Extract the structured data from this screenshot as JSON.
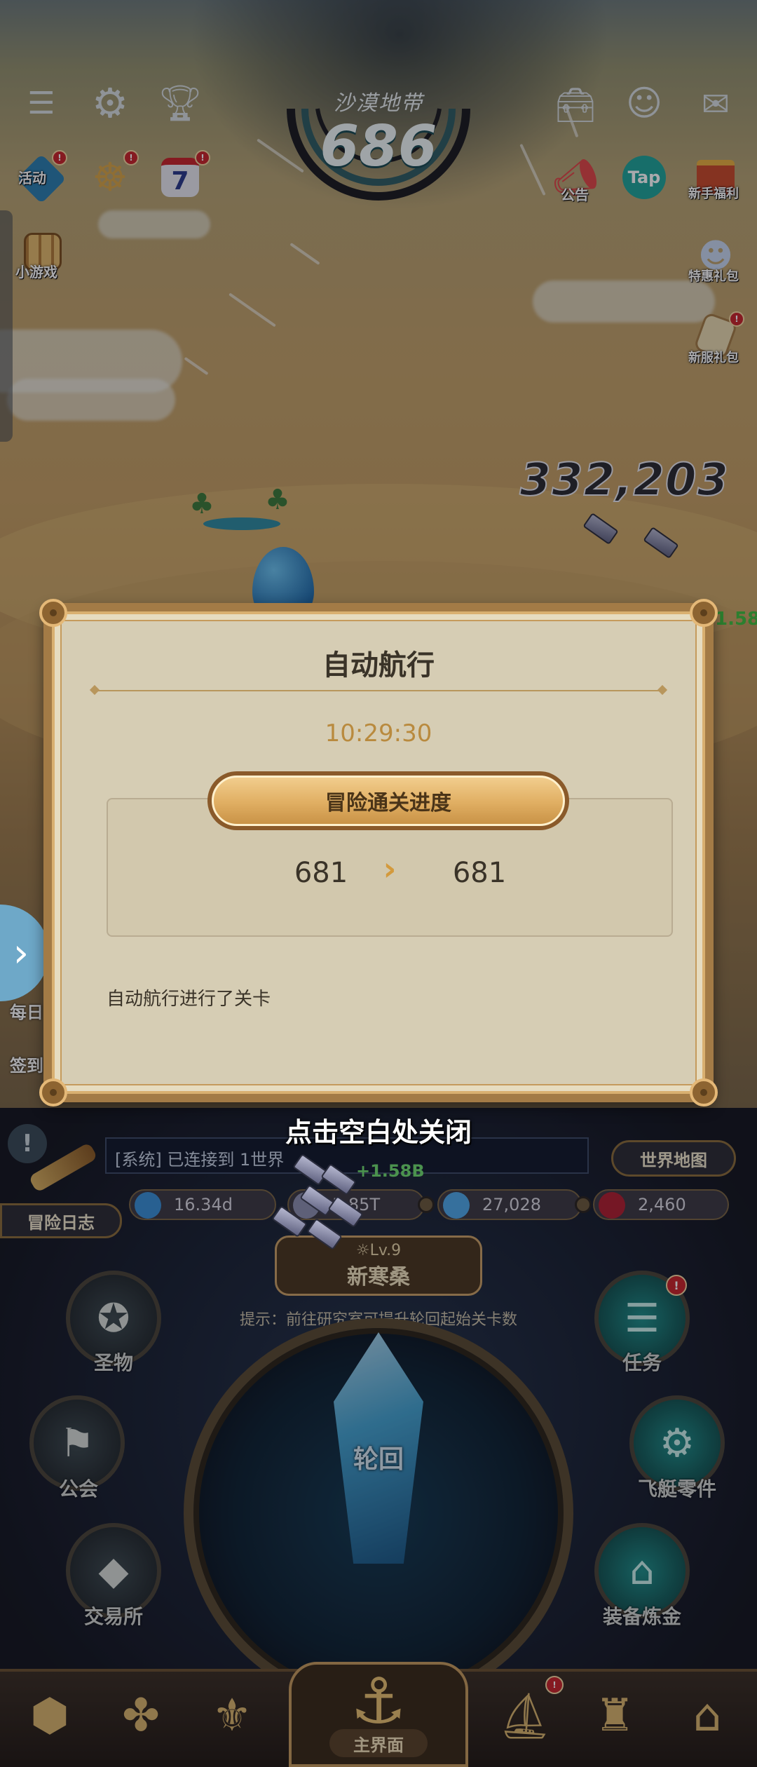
{
  "hud": {
    "stage_name": "沙漠地带",
    "stage_number": "686",
    "left_icons": [
      {
        "label": "活动",
        "icon": "activity-icon"
      },
      {
        "label": "",
        "icon": "helm-icon"
      },
      {
        "label": "7",
        "icon": "calendar-icon"
      },
      {
        "label": "小游戏",
        "icon": "minigame-icon"
      }
    ],
    "right_icons": [
      {
        "label": "公告",
        "icon": "megaphone-icon"
      },
      {
        "label": "Tap",
        "icon": "tap-icon"
      },
      {
        "label": "新手福利",
        "icon": "gift-icon"
      },
      {
        "label": "特惠礼包",
        "icon": "character-icon"
      },
      {
        "label": "新服礼包",
        "icon": "scroll-icon"
      }
    ],
    "power": "332,203",
    "side_green": "1.58",
    "left_peek_1": "每日",
    "left_peek_2": "签到"
  },
  "dialog": {
    "title": "自动航行",
    "time": "10:29:30",
    "banner": "冒险通关进度",
    "from_level": "681",
    "arrow": "›",
    "to_level": "681",
    "description": "自动航行进行了关卡"
  },
  "close_hint": "点击空白处关闭",
  "console": {
    "chat_text": "[系统] 已连接到 1世界",
    "chat_gain": "+1.58B",
    "world_map": "世界地图",
    "adventure_log": "冒险日志",
    "resources": [
      {
        "value": "16.34d",
        "icon": "potion-icon",
        "color": "#3a8fd6"
      },
      {
        "value": "5.85T",
        "icon": "ingot-icon",
        "color": "#8c8fb0"
      },
      {
        "value": "27,028",
        "icon": "diamond-icon",
        "color": "#4fa8e8"
      },
      {
        "value": "2,460",
        "icon": "ruby-icon",
        "color": "#b02030"
      }
    ],
    "ship_level": "☼Lv.9",
    "ship_name": "新寒桑",
    "tip": "提示：前往研究室可提升轮回起始关卡数",
    "reactor_label": "轮回",
    "left_buttons": [
      "圣物",
      "公会",
      "交易所"
    ],
    "right_buttons": [
      "任务",
      "飞艇零件",
      "装备炼金"
    ]
  },
  "bottom_nav": {
    "main_label": "主界面"
  },
  "colors": {
    "dialog_frame": "#a37b46",
    "dialog_bg": "#e6dcc0",
    "time_color": "#b98a3e",
    "badge_red": "#c8242a"
  }
}
